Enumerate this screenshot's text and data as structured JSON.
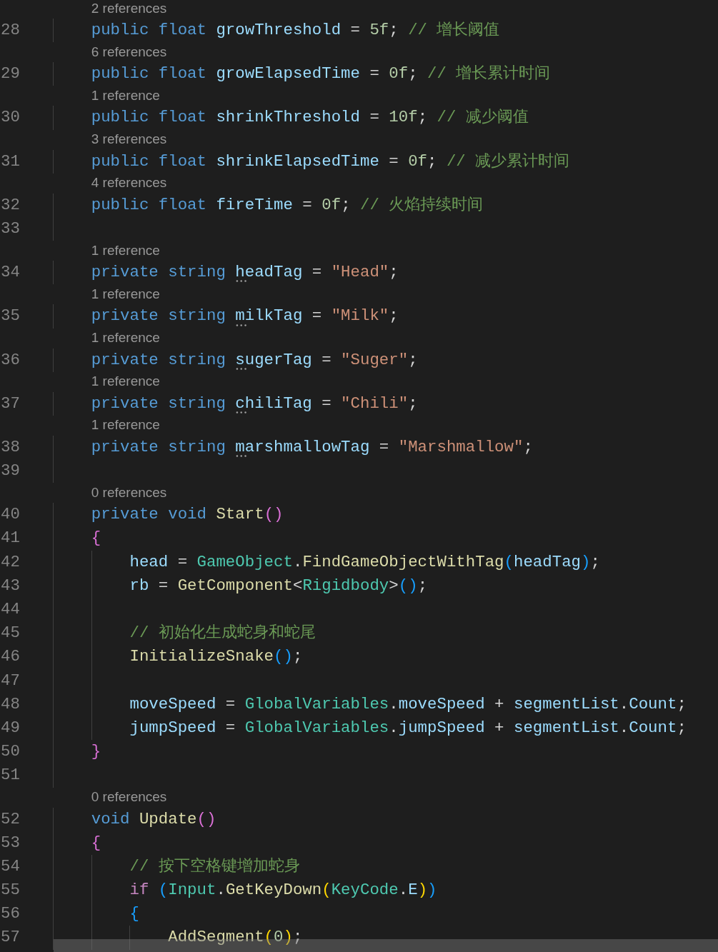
{
  "lines": [
    {
      "codelens": "2 references",
      "number": "28",
      "tokens": [
        {
          "text": "    public float",
          "kind": "kw"
        },
        {
          "text": " growThreshold",
          "kind": "var"
        },
        {
          "text": " = ",
          "kind": "punc"
        },
        {
          "text": "5f",
          "kind": "num"
        },
        {
          "text": "; ",
          "kind": "punc"
        },
        {
          "text": "// 增长阈值",
          "kind": "cmt"
        }
      ]
    },
    {
      "codelens": "6 references",
      "number": "29",
      "tokens": [
        {
          "text": "    public float",
          "kind": "kw"
        },
        {
          "text": " growElapsedTime",
          "kind": "var"
        },
        {
          "text": " = ",
          "kind": "punc"
        },
        {
          "text": "0f",
          "kind": "num"
        },
        {
          "text": "; ",
          "kind": "punc"
        },
        {
          "text": "// 增长累计时间",
          "kind": "cmt"
        }
      ]
    },
    {
      "codelens": "1 reference",
      "number": "30",
      "tokens": [
        {
          "text": "    public float",
          "kind": "kw"
        },
        {
          "text": " shrinkThreshold",
          "kind": "var"
        },
        {
          "text": " = ",
          "kind": "punc"
        },
        {
          "text": "10f",
          "kind": "num"
        },
        {
          "text": "; ",
          "kind": "punc"
        },
        {
          "text": "// 减少阈值",
          "kind": "cmt"
        }
      ]
    },
    {
      "codelens": "3 references",
      "number": "31",
      "tokens": [
        {
          "text": "    public float",
          "kind": "kw"
        },
        {
          "text": " shrinkElapsedTime",
          "kind": "var"
        },
        {
          "text": " = ",
          "kind": "punc"
        },
        {
          "text": "0f",
          "kind": "num"
        },
        {
          "text": "; ",
          "kind": "punc"
        },
        {
          "text": "// 减少累计时间",
          "kind": "cmt"
        }
      ]
    },
    {
      "codelens": "4 references",
      "number": "32",
      "tokens": [
        {
          "text": "    public float",
          "kind": "kw"
        },
        {
          "text": " fireTime",
          "kind": "var"
        },
        {
          "text": " = ",
          "kind": "punc"
        },
        {
          "text": "0f",
          "kind": "num"
        },
        {
          "text": "; ",
          "kind": "punc"
        },
        {
          "text": "// 火焰持续时间",
          "kind": "cmt"
        }
      ]
    },
    {
      "number": "33"
    },
    {
      "codelens": "1 reference",
      "number": "34",
      "tokens": [
        {
          "text": "    private string ",
          "kind": "kw"
        },
        {
          "text": "headTag",
          "kind": "var",
          "hinted": true
        },
        {
          "text": " = ",
          "kind": "punc"
        },
        {
          "text": "\"Head\"",
          "kind": "str"
        },
        {
          "text": ";",
          "kind": "punc"
        }
      ]
    },
    {
      "codelens": "1 reference",
      "number": "35",
      "tokens": [
        {
          "text": "    private string ",
          "kind": "kw"
        },
        {
          "text": "milkTag",
          "kind": "var",
          "hinted": true
        },
        {
          "text": " = ",
          "kind": "punc"
        },
        {
          "text": "\"Milk\"",
          "kind": "str"
        },
        {
          "text": ";",
          "kind": "punc"
        }
      ]
    },
    {
      "codelens": "1 reference",
      "number": "36",
      "tokens": [
        {
          "text": "    private string ",
          "kind": "kw"
        },
        {
          "text": "sugerTag",
          "kind": "var",
          "hinted": true
        },
        {
          "text": " = ",
          "kind": "punc"
        },
        {
          "text": "\"Suger\"",
          "kind": "str"
        },
        {
          "text": ";",
          "kind": "punc"
        }
      ]
    },
    {
      "codelens": "1 reference",
      "number": "37",
      "tokens": [
        {
          "text": "    private string ",
          "kind": "kw"
        },
        {
          "text": "chiliTag",
          "kind": "var",
          "hinted": true
        },
        {
          "text": " = ",
          "kind": "punc"
        },
        {
          "text": "\"Chili\"",
          "kind": "str"
        },
        {
          "text": ";",
          "kind": "punc"
        }
      ]
    },
    {
      "codelens": "1 reference",
      "number": "38",
      "tokens": [
        {
          "text": "    private string ",
          "kind": "kw"
        },
        {
          "text": "marshmallowTag",
          "kind": "var",
          "hinted": true
        },
        {
          "text": " = ",
          "kind": "punc"
        },
        {
          "text": "\"Marshmallow\"",
          "kind": "str"
        },
        {
          "text": ";",
          "kind": "punc"
        }
      ]
    },
    {
      "number": "39"
    },
    {
      "codelens": "0 references",
      "number": "40",
      "tokens": [
        {
          "text": "    private void",
          "kind": "kw"
        },
        {
          "text": " Start",
          "kind": "fn"
        },
        {
          "text": "()",
          "kind": "b1"
        }
      ]
    },
    {
      "number": "41",
      "tokens": [
        {
          "text": "    {",
          "kind": "b1"
        }
      ]
    },
    {
      "number": "42",
      "tokens": [
        {
          "text": "        head",
          "kind": "var"
        },
        {
          "text": " = ",
          "kind": "punc"
        },
        {
          "text": "GameObject",
          "kind": "type"
        },
        {
          "text": ".",
          "kind": "punc"
        },
        {
          "text": "FindGameObjectWithTag",
          "kind": "fn"
        },
        {
          "text": "(",
          "kind": "b2"
        },
        {
          "text": "headTag",
          "kind": "var"
        },
        {
          "text": ")",
          "kind": "b2"
        },
        {
          "text": ";",
          "kind": "punc"
        }
      ]
    },
    {
      "number": "43",
      "tokens": [
        {
          "text": "        rb",
          "kind": "var"
        },
        {
          "text": " = ",
          "kind": "punc"
        },
        {
          "text": "GetComponent",
          "kind": "fn"
        },
        {
          "text": "<",
          "kind": "punc"
        },
        {
          "text": "Rigidbody",
          "kind": "type"
        },
        {
          "text": ">",
          "kind": "punc"
        },
        {
          "text": "()",
          "kind": "b2"
        },
        {
          "text": ";",
          "kind": "punc"
        }
      ]
    },
    {
      "number": "44"
    },
    {
      "number": "45",
      "tokens": [
        {
          "text": "        // 初始化生成蛇身和蛇尾",
          "kind": "cmt"
        }
      ]
    },
    {
      "number": "46",
      "tokens": [
        {
          "text": "        InitializeSnake",
          "kind": "fn"
        },
        {
          "text": "()",
          "kind": "b2"
        },
        {
          "text": ";",
          "kind": "punc"
        }
      ]
    },
    {
      "number": "47"
    },
    {
      "number": "48",
      "tokens": [
        {
          "text": "        moveSpeed",
          "kind": "var"
        },
        {
          "text": " = ",
          "kind": "punc"
        },
        {
          "text": "GlobalVariables",
          "kind": "type"
        },
        {
          "text": ".",
          "kind": "punc"
        },
        {
          "text": "moveSpeed",
          "kind": "var"
        },
        {
          "text": " + ",
          "kind": "punc"
        },
        {
          "text": "segmentList",
          "kind": "var"
        },
        {
          "text": ".",
          "kind": "punc"
        },
        {
          "text": "Count",
          "kind": "var"
        },
        {
          "text": ";",
          "kind": "punc"
        }
      ]
    },
    {
      "number": "49",
      "tokens": [
        {
          "text": "        jumpSpeed",
          "kind": "var"
        },
        {
          "text": " = ",
          "kind": "punc"
        },
        {
          "text": "GlobalVariables",
          "kind": "type"
        },
        {
          "text": ".",
          "kind": "punc"
        },
        {
          "text": "jumpSpeed",
          "kind": "var"
        },
        {
          "text": " + ",
          "kind": "punc"
        },
        {
          "text": "segmentList",
          "kind": "var"
        },
        {
          "text": ".",
          "kind": "punc"
        },
        {
          "text": "Count",
          "kind": "var"
        },
        {
          "text": ";",
          "kind": "punc"
        }
      ]
    },
    {
      "number": "50",
      "tokens": [
        {
          "text": "    }",
          "kind": "b1"
        }
      ]
    },
    {
      "number": "51"
    },
    {
      "codelens": "0 references",
      "number": "52",
      "tokens": [
        {
          "text": "    void",
          "kind": "kw"
        },
        {
          "text": " Update",
          "kind": "fn"
        },
        {
          "text": "()",
          "kind": "b1"
        }
      ]
    },
    {
      "number": "53",
      "tokens": [
        {
          "text": "    {",
          "kind": "b1"
        }
      ]
    },
    {
      "number": "54",
      "tokens": [
        {
          "text": "        // 按下空格键增加蛇身",
          "kind": "cmt"
        }
      ]
    },
    {
      "number": "55",
      "tokens": [
        {
          "text": "        if ",
          "kind": "ctl"
        },
        {
          "text": "(",
          "kind": "b2"
        },
        {
          "text": "Input",
          "kind": "type"
        },
        {
          "text": ".",
          "kind": "punc"
        },
        {
          "text": "GetKeyDown",
          "kind": "fn"
        },
        {
          "text": "(",
          "kind": "b3"
        },
        {
          "text": "KeyCode",
          "kind": "type"
        },
        {
          "text": ".",
          "kind": "punc"
        },
        {
          "text": "E",
          "kind": "var"
        },
        {
          "text": ")",
          "kind": "b3"
        },
        {
          "text": ")",
          "kind": "b2"
        }
      ]
    },
    {
      "number": "56",
      "tokens": [
        {
          "text": "        {",
          "kind": "b2"
        }
      ]
    },
    {
      "number": "57",
      "tokens": [
        {
          "text": "            AddSegment",
          "kind": "fn"
        },
        {
          "text": "(",
          "kind": "b3"
        },
        {
          "text": "0",
          "kind": "num"
        },
        {
          "text": ")",
          "kind": "b3"
        },
        {
          "text": ";",
          "kind": "punc"
        }
      ]
    }
  ]
}
